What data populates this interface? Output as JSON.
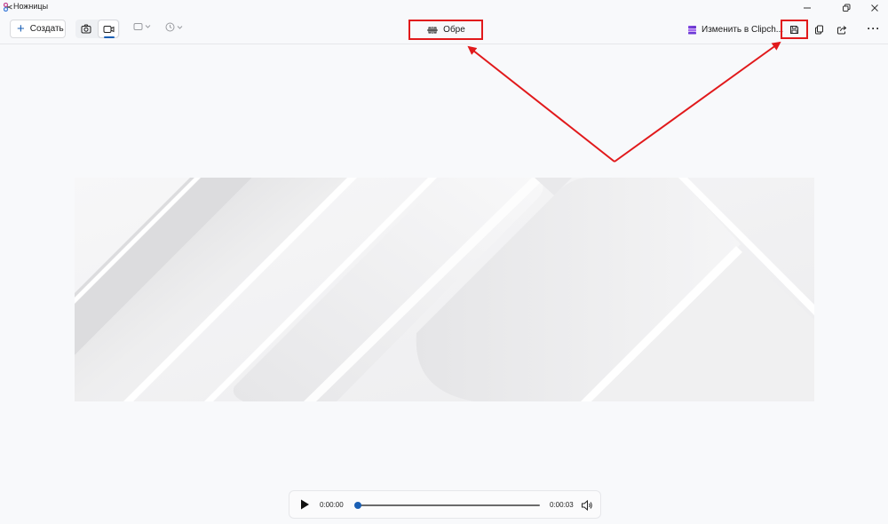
{
  "window": {
    "title": "Ножницы",
    "icons": {
      "app": "scissors-app-icon",
      "minimize": "minimize-icon",
      "maximize": "restore-icon",
      "close": "close-icon"
    }
  },
  "toolbar": {
    "new_label": "Создать",
    "new_icon": "plus-icon",
    "modes": [
      {
        "name": "photo-mode",
        "icon": "camera-icon",
        "selected": false
      },
      {
        "name": "video-mode",
        "icon": "video-camera-icon",
        "selected": true
      }
    ],
    "shape_dropdown_icon": "rectangle-icon",
    "timer_dropdown_icon": "clock-icon",
    "trim_label": "Обре",
    "trim_icon": "trim-icon",
    "clipchamp_label": "Изменить в Clipch...",
    "clipchamp_icon": "clipchamp-icon",
    "save_icon": "save-icon",
    "copy_icon": "copy-icon",
    "share_icon": "share-icon",
    "more_label": "···"
  },
  "player": {
    "current_time": "0:00:00",
    "duration": "0:00:03",
    "progress": 0.0,
    "play_icon": "play-icon",
    "volume_icon": "volume-icon"
  },
  "annotation": {
    "highlight_color": "#e1191b"
  }
}
